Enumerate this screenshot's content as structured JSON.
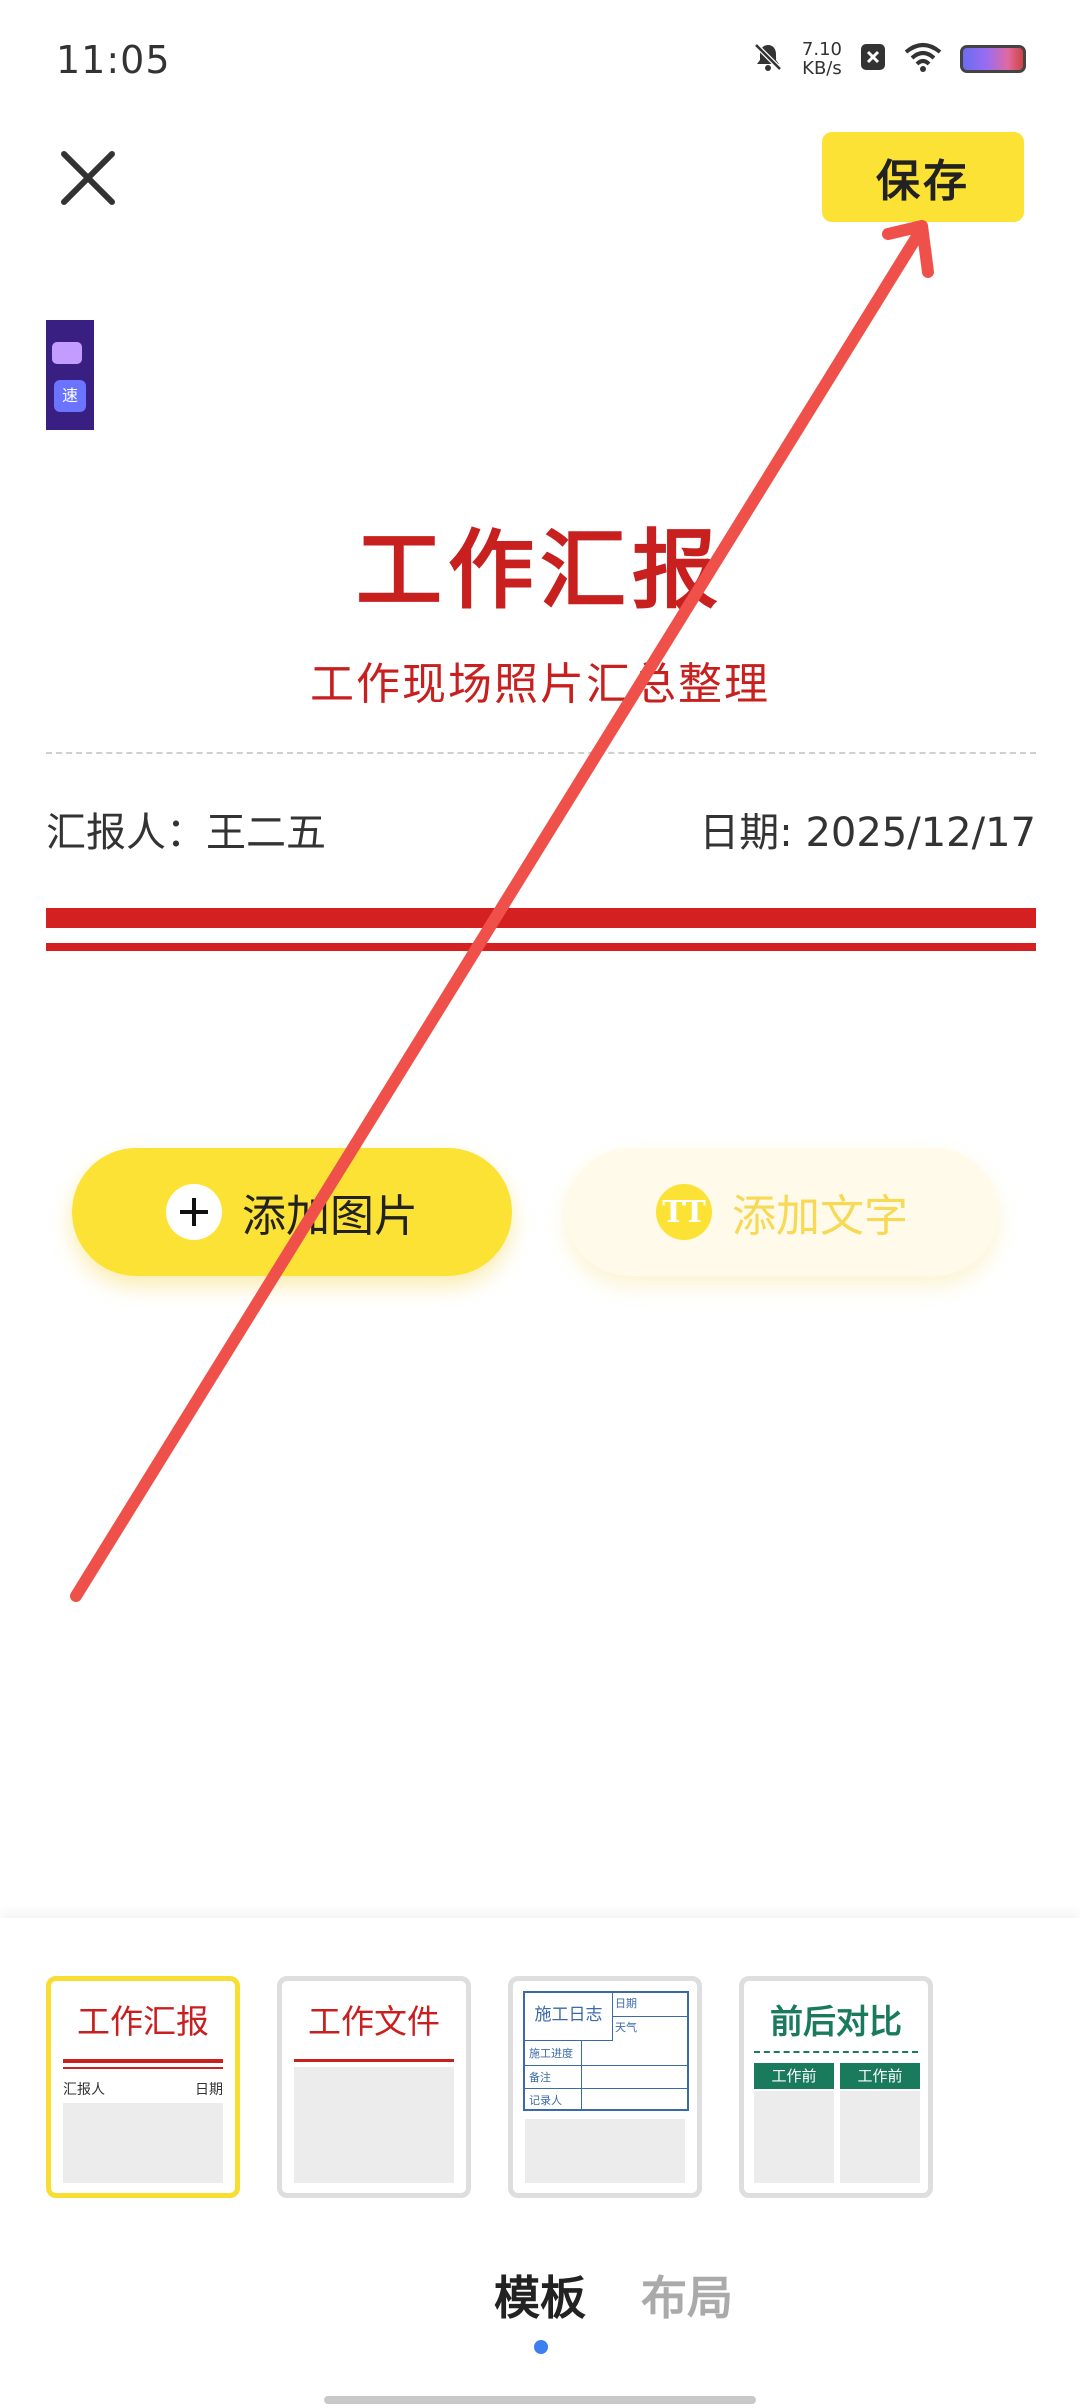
{
  "status_bar": {
    "time": "11:05",
    "net_speed_value": "7.10",
    "net_speed_unit": "KB/s",
    "icons": [
      "bell-muted-icon",
      "close-box-icon",
      "wifi-icon",
      "battery-icon"
    ]
  },
  "header": {
    "close_icon": "close-icon",
    "save_label": "保存"
  },
  "thumbnail": {
    "key_label": "速"
  },
  "document": {
    "title": "工作汇报",
    "subtitle": "工作现场照片汇总整理",
    "reporter_label": "汇报人：",
    "reporter_name": "王二五",
    "date_label": "日期: ",
    "date_value": "2025/12/17",
    "accent_color": "#c81f1f"
  },
  "actions": {
    "add_image_label": "添加图片",
    "add_image_icon": "plus-icon",
    "add_text_label": "添加文字",
    "add_text_icon": "text-tt-icon",
    "add_text_icon_glyph": "TT"
  },
  "templates": [
    {
      "title": "工作汇报",
      "sub_left": "汇报人",
      "sub_right": "日期",
      "selected": true
    },
    {
      "title": "工作文件",
      "selected": false
    },
    {
      "title": "施工日志",
      "fields": [
        "日期",
        "天气",
        "施工进度",
        "备注",
        "记录人"
      ],
      "selected": false
    },
    {
      "title": "前后对比",
      "labels": [
        "工作前",
        "工作前"
      ],
      "selected": false
    }
  ],
  "tabs": {
    "template_label": "模板",
    "layout_label": "布局",
    "active": "模板"
  },
  "colors": {
    "yellow": "#fde236",
    "red": "#d42020",
    "green": "#1a7a5c",
    "blue": "#3b6aa8",
    "annotation_arrow": "#f0504a"
  }
}
